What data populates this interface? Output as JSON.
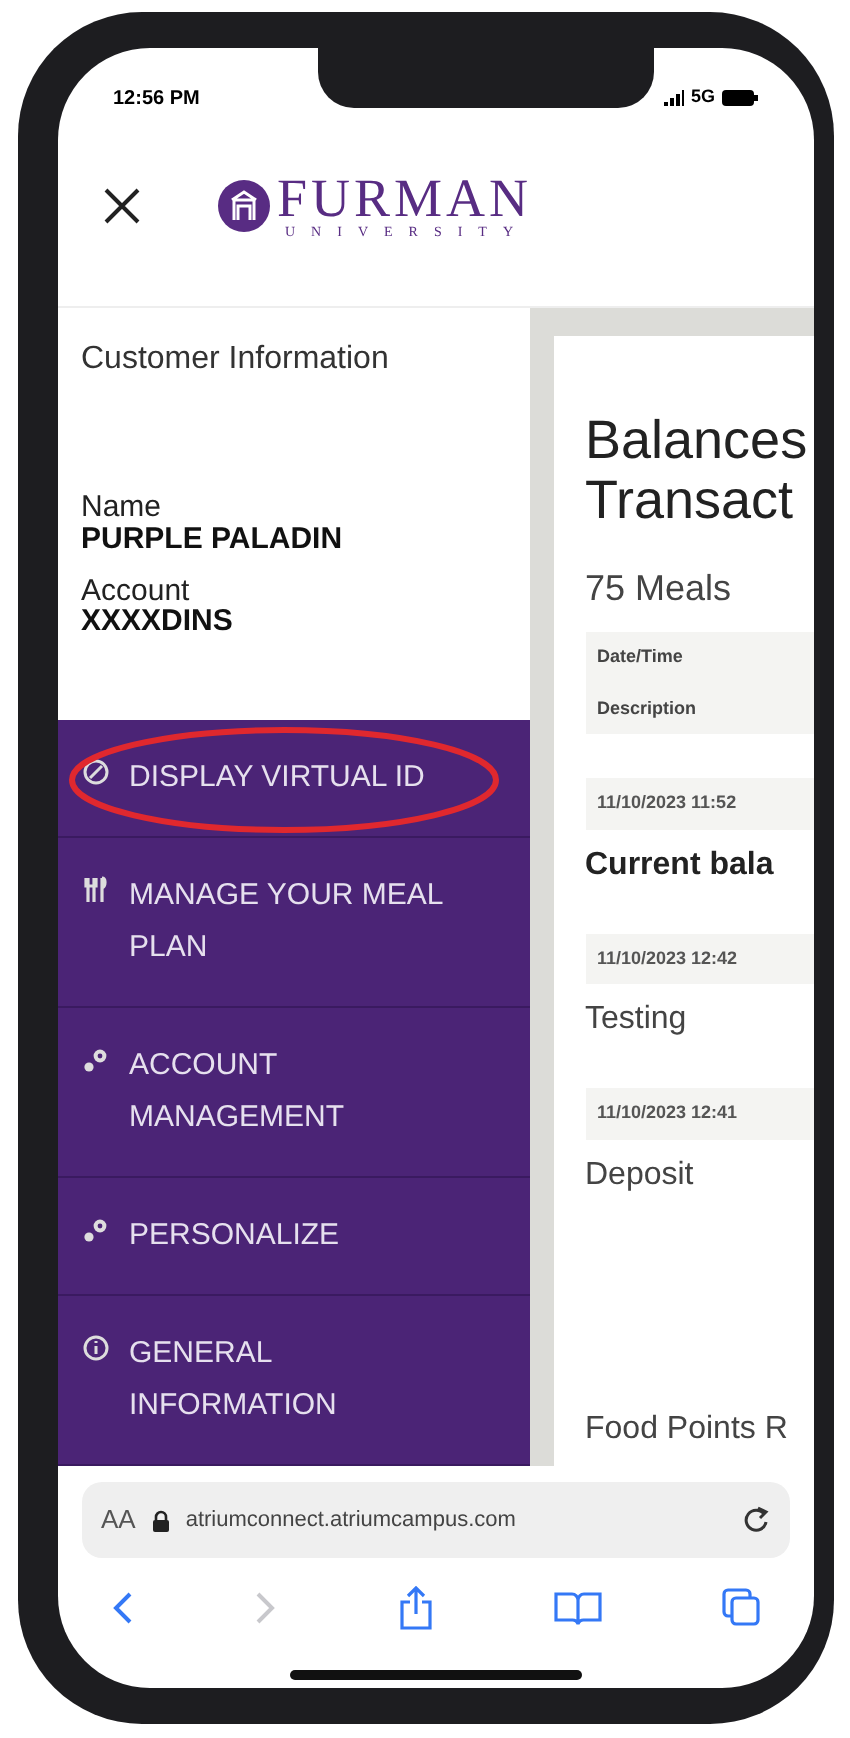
{
  "status_bar": {
    "time": "12:56 PM",
    "network": "5G"
  },
  "header": {
    "logo_name": "FURMAN",
    "logo_subtitle": "UNIVERSITY"
  },
  "customer": {
    "heading": "Customer Information",
    "fields": [
      {
        "label": "Name",
        "value": "PURPLE PALADIN"
      },
      {
        "label": "Account",
        "value": "XXXXDINS"
      }
    ]
  },
  "menu": [
    {
      "kind": "virtual_id",
      "label": "DISPLAY VIRTUAL ID",
      "circled": true
    },
    {
      "kind": "meal_plan",
      "label": "MANAGE YOUR MEAL PLAN",
      "circled": false
    },
    {
      "kind": "account",
      "label": "ACCOUNT MANAGEMENT",
      "circled": false
    },
    {
      "kind": "personalize",
      "label": "PERSONALIZE",
      "circled": false
    },
    {
      "kind": "info",
      "label": "GENERAL INFORMATION",
      "circled": false
    }
  ],
  "balances": {
    "title_lines": [
      "Balances",
      "Transact"
    ],
    "plan": "75 Meals",
    "columns": [
      "Date/Time",
      "Description"
    ],
    "rows": [
      {
        "date": "11/10/2023 11:52",
        "description": "Current bala",
        "bold": true
      },
      {
        "date": "11/10/2023 12:42",
        "description": "Testing",
        "bold": false
      },
      {
        "date": "11/10/2023 12:41",
        "description": "Deposit",
        "bold": false
      }
    ],
    "next_section": "Food Points R"
  },
  "browser": {
    "text_size": "AA",
    "url": "atriumconnect.atriumcampus.com",
    "forward_disabled": true
  }
}
